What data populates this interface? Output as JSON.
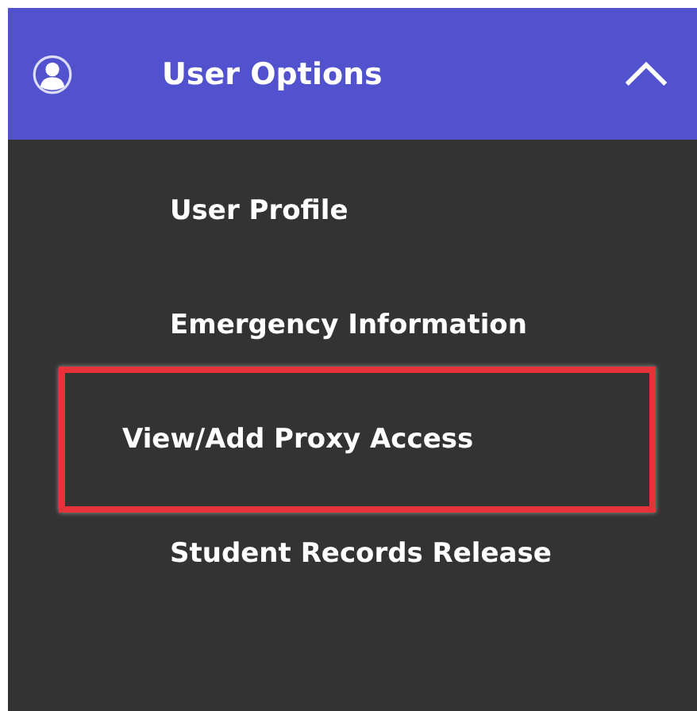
{
  "header": {
    "title": "User Options",
    "expanded": true
  },
  "menu": [
    {
      "label": "User Profile",
      "selected": false
    },
    {
      "label": "Emergency Information",
      "selected": false
    },
    {
      "label": "View/Add Proxy Access",
      "selected": true
    },
    {
      "label": "Student Records Release",
      "selected": false
    }
  ]
}
